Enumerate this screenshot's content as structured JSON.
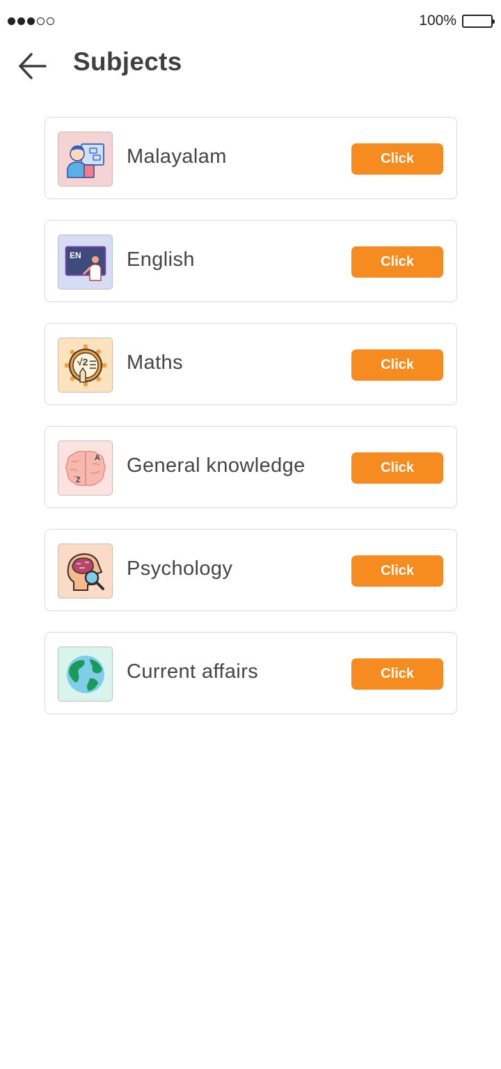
{
  "status_bar": {
    "signal_filled": 3,
    "signal_total": 5,
    "battery_percent_label": "100%",
    "battery_level": 1.0
  },
  "header": {
    "back_icon": "arrow-left-icon",
    "title": "Subjects"
  },
  "colors": {
    "accent": "#f68b1f",
    "title_text": "#3f3f3f",
    "card_border": "#dcdcdc"
  },
  "subjects": [
    {
      "name": "Malayalam",
      "icon": "teacher-icon",
      "icon_bg": "#f5d3d3",
      "button_label": "Click"
    },
    {
      "name": "English",
      "icon": "english-blackboard-icon",
      "icon_bg": "#d6dcf3",
      "button_label": "Click"
    },
    {
      "name": "Maths",
      "icon": "math-gear-icon",
      "icon_bg": "#fde3bd",
      "button_label": "Click"
    },
    {
      "name": "General knowledge",
      "icon": "brain-icon",
      "icon_bg": "#fde3e0",
      "button_label": "Click"
    },
    {
      "name": "Psychology",
      "icon": "head-magnifier-icon",
      "icon_bg": "#fbdac6",
      "button_label": "Click"
    },
    {
      "name": "Current affairs",
      "icon": "globe-icon",
      "icon_bg": "#d9f4ea",
      "button_label": "Click"
    }
  ]
}
